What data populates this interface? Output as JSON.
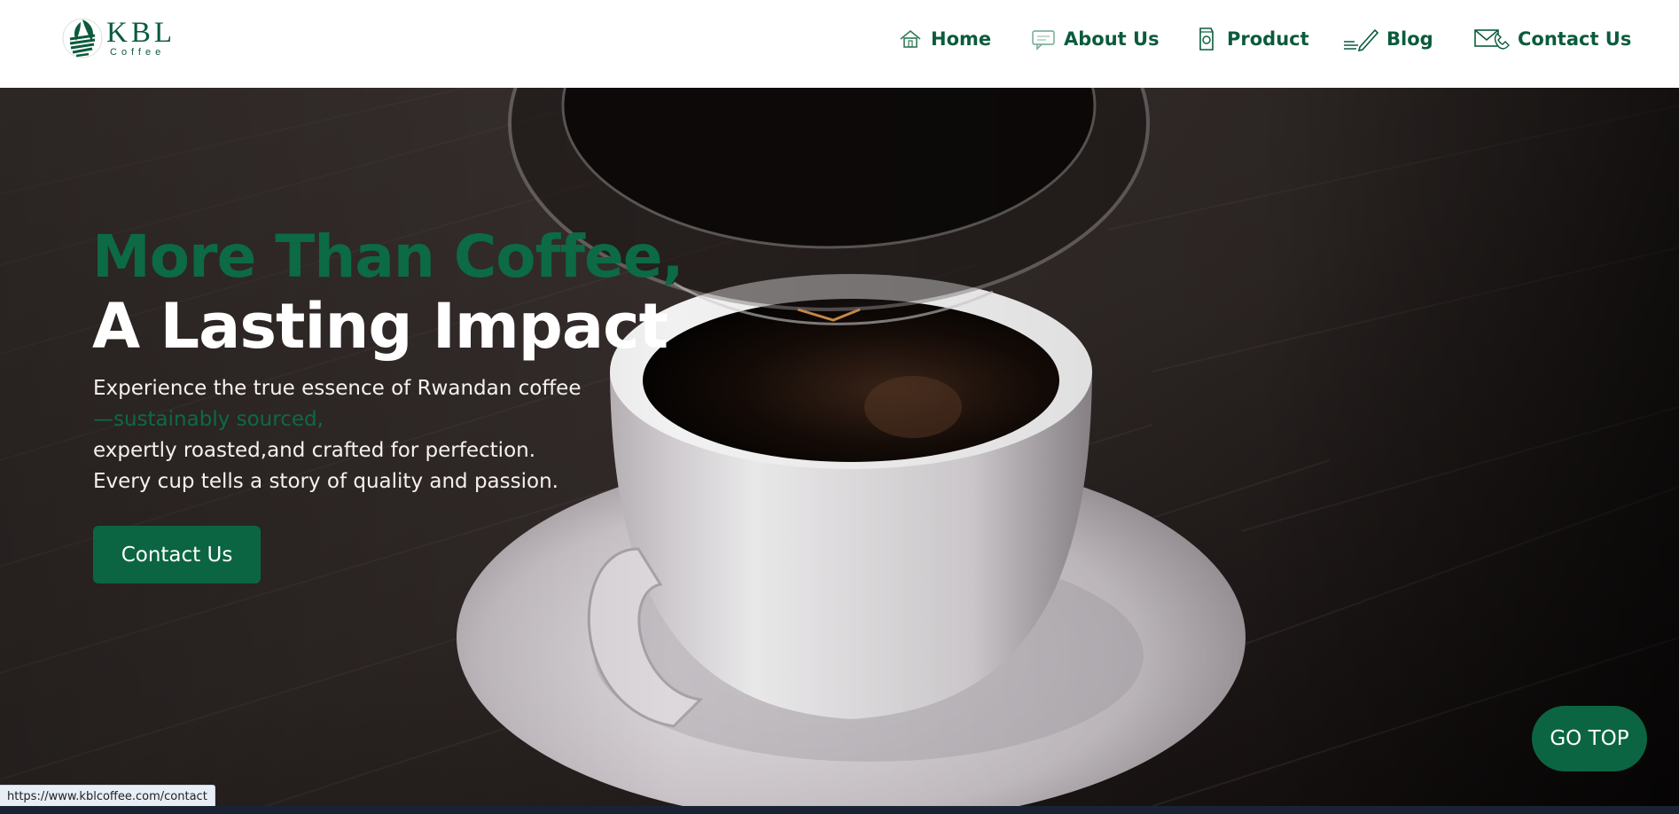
{
  "header": {
    "logo": {
      "brand": "KBL",
      "sub": "Coffee"
    },
    "nav": [
      {
        "label": "Home",
        "icon": "home-icon"
      },
      {
        "label": "About Us",
        "icon": "chat-bubble-icon"
      },
      {
        "label": "Product",
        "icon": "coffee-bag-icon"
      },
      {
        "label": "Blog",
        "icon": "pencil-icon"
      },
      {
        "label": "Contact Us",
        "icon": "envelope-phone-icon"
      }
    ]
  },
  "hero": {
    "headline_green": "More Than Coffee,",
    "headline_white": "A Lasting Impact",
    "lines": [
      "Experience the true essence of Rwandan coffee",
      "—sustainably sourced,",
      "expertly roasted,and crafted for perfection.",
      "Every cup tells a story of quality and passion."
    ],
    "cta_label": "Contact Us"
  },
  "go_top_label": "GO TOP",
  "status_url": "https://www.kblcoffee.com/contact",
  "colors": {
    "brand_green": "#0b6543",
    "headline_green": "#0c6a45",
    "header_bg": "#ffffff"
  }
}
